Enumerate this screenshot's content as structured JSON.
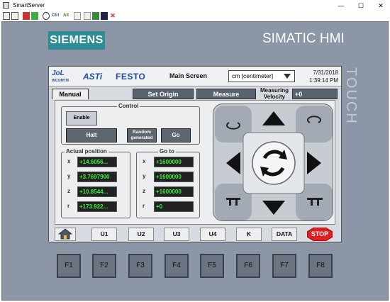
{
  "window": {
    "title": "SmartServer",
    "controls": [
      "—",
      "☐",
      "✕"
    ]
  },
  "toolbar": {
    "items": [
      "Ctrl",
      "Alt"
    ]
  },
  "device": {
    "brand": "SIEMENS",
    "product": "SIMATIC HMI",
    "touch_label": "TOUCH"
  },
  "header": {
    "logo1": "JoL",
    "logo1_sub": "INCOMTM",
    "logo2": "ASTi",
    "logo3": "FESTO",
    "screen_name": "Main Screen",
    "unit_value": "cm [centimeter]",
    "date": "7/31/2018",
    "time": "1:39:14 PM"
  },
  "tabs": {
    "manual": "Manual",
    "set_origin": "Set Origin",
    "measure": "Measure",
    "velocity_label": "Measuring Velocity",
    "velocity_value": "+0"
  },
  "control": {
    "title": "Control",
    "enable": "Enable",
    "halt": "Halt",
    "random": "Random generated",
    "go": "Go"
  },
  "actual": {
    "title": "Actual position",
    "rows": [
      {
        "axis": "x",
        "value": "+14.6056..."
      },
      {
        "axis": "y",
        "value": "+3.7697900"
      },
      {
        "axis": "z",
        "value": "+10.8544..."
      },
      {
        "axis": "r",
        "value": "+173.922..."
      }
    ]
  },
  "goto": {
    "title": "Go to",
    "rows": [
      {
        "axis": "x",
        "value": "+1600000"
      },
      {
        "axis": "y",
        "value": "+1600000"
      },
      {
        "axis": "z",
        "value": "+1600000"
      },
      {
        "axis": "r",
        "value": "+0"
      }
    ]
  },
  "function_row": {
    "items": [
      "U1",
      "U2",
      "U3",
      "U4",
      "K",
      "DATA"
    ],
    "stop": "STOP"
  },
  "fkeys": [
    "F1",
    "F2",
    "F3",
    "F4",
    "F5",
    "F6",
    "F7",
    "F8"
  ],
  "colors": {
    "accent": "#2d8c94",
    "value_green": "#3df03d",
    "stop_red": "#e02020"
  }
}
